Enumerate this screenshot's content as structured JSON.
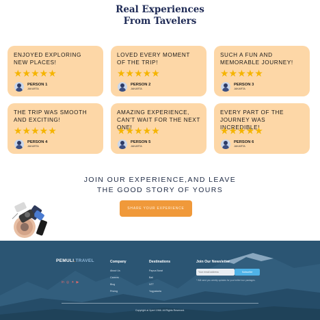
{
  "heading": {
    "line1": "Real Experiences",
    "line2": "From Tavelers"
  },
  "testimonials": [
    {
      "quote": "ENJOYED EXPLORING NEW PLACES!",
      "stars": "★★★★★",
      "name": "PERSON 1",
      "location": "JAKARTA"
    },
    {
      "quote": "LOVED EVERY MOMENT OF THE TRIP!",
      "stars": "★★★★★",
      "name": "PERSON 2",
      "location": "JAKARTA"
    },
    {
      "quote": "SUCH A FUN AND MEMORABLE JOURNEY!",
      "stars": "★★★★★",
      "name": "PERSON 3",
      "location": "JAKARTA"
    },
    {
      "quote": "THE TRIP WAS SMOOTH AND EXCITING!",
      "stars": "★★★★★",
      "name": "PERSON 4",
      "location": "JAKARTA"
    },
    {
      "quote": "AMAZING EXPERIENCE, CAN'T WAIT FOR THE NEXT ONE!",
      "stars": "★★★★★",
      "name": "PERSON 5",
      "location": "JAKARTA"
    },
    {
      "quote": "EVERY PART OF THE JOURNEY WAS INCREDIBLE!",
      "stars": "★★★★★",
      "name": "PERSON 6",
      "location": "JAKARTA"
    }
  ],
  "cta": {
    "line1": "JOIN OUR EXPERIENCE,AND LEAVE",
    "line2": "THE GOOD STORY OF YOURS",
    "button": "SHARE YOUR EXPERIENCE"
  },
  "footer": {
    "logo_main": "PEMULI",
    "logo_dot": ".",
    "logo_tail": "TRAVEL",
    "social_icons": [
      "linkedin-icon",
      "instagram-icon",
      "twitter-icon",
      "youtube-icon"
    ],
    "social_glyphs": [
      "in",
      "◎",
      "✦",
      "▶"
    ],
    "company": {
      "title": "Company",
      "items": [
        "About Us",
        "Careers",
        "Blog",
        "Pricing"
      ]
    },
    "destinations": {
      "title": "Destinations",
      "items": [
        "Papua Barat",
        "Bali",
        "NTT",
        "Yogyakarta"
      ]
    },
    "newsletter": {
      "title": "Join Our Newsletter",
      "placeholder": "Your email address",
      "button": "Subscribe",
      "note": "* Will send you weekly updates for your better tour packages."
    },
    "copyright": "Copyright ai Xpert 1966. All Rights Reserved.",
    "colors": {
      "background": "#2b5573",
      "accent": "#f0993a",
      "button": "#4fb3e8"
    }
  },
  "colors": {
    "card": "#fdd7a7",
    "star": "#f5b400",
    "heading": "#1e2a55",
    "cta_button": "#f0993a"
  }
}
